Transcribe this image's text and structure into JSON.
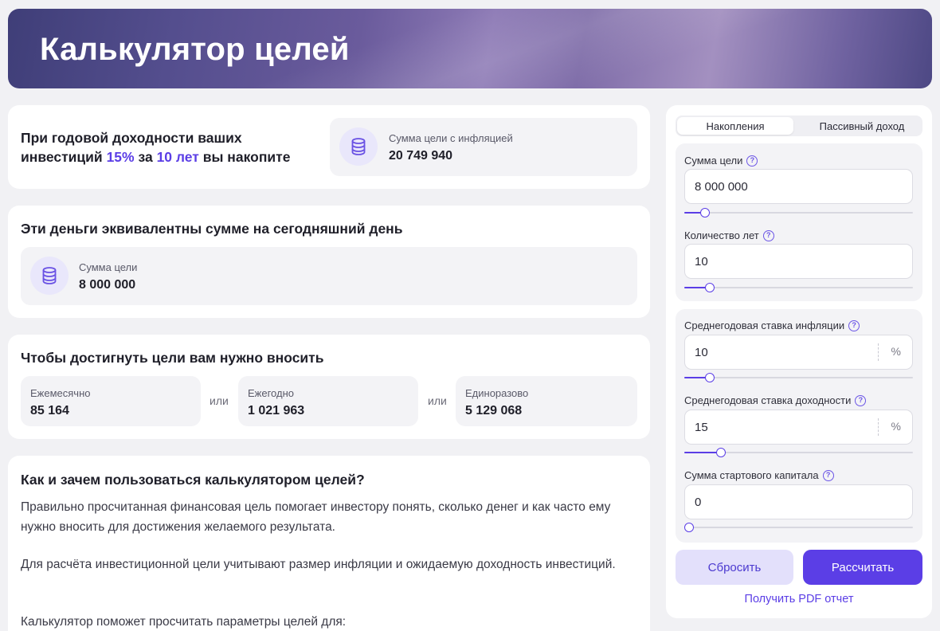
{
  "header": {
    "title": "Калькулятор целей"
  },
  "summary": {
    "line1": "При годовой доходности ваших",
    "line2_prefix": "инвестиций",
    "rate": "15%",
    "mid": "за",
    "years": "10 лет",
    "line2_suffix": "вы накопите",
    "stat_label": "Сумма цели с инфляцией",
    "stat_value": "20 749 940"
  },
  "equivalent": {
    "title": "Эти деньги эквивалентны сумме на сегодняшний день",
    "stat_label": "Сумма цели",
    "stat_value": "8 000 000"
  },
  "contributions": {
    "title": "Чтобы достигнуть цели вам нужно вносить",
    "or_label": "или",
    "items": [
      {
        "label": "Ежемесячно",
        "value": "85 164"
      },
      {
        "label": "Ежегодно",
        "value": "1 021 963"
      },
      {
        "label": "Единоразово",
        "value": "5 129 068"
      }
    ]
  },
  "info": {
    "title": "Как и зачем пользоваться калькулятором целей?",
    "paragraphs": [
      "Правильно просчитанная финансовая цель помогает инвестору понять, сколько денег и как часто ему нужно вносить для достижения желаемого результата.",
      "Для расчёта инвестиционной цели учитывают размер инфляции и ожидаемую доходность инвестиций.",
      "Калькулятор поможет просчитать параметры целей для:"
    ]
  },
  "sidebar": {
    "tabs": [
      {
        "label": "Накопления",
        "active": true
      },
      {
        "label": "Пассивный доход",
        "active": false
      }
    ],
    "help_glyph": "?",
    "fields": [
      {
        "label": "Сумма цели",
        "value": "8 000 000",
        "unit": "",
        "slider_level": 0.09
      },
      {
        "label": "Количество лет",
        "value": "10",
        "unit": "",
        "slider_level": 0.11
      },
      {
        "label": "Среднегодовая ставка инфляции",
        "value": "10",
        "unit": "%",
        "slider_level": 0.11
      },
      {
        "label": "Среднегодовая ставка доходности",
        "value": "15",
        "unit": "%",
        "slider_level": 0.16
      },
      {
        "label": "Сумма стартового капитала",
        "value": "0",
        "unit": "",
        "slider_level": 0.0
      }
    ],
    "reset_label": "Сбросить",
    "calc_label": "Рассчитать",
    "pdf_label": "Получить PDF отчет"
  },
  "colors": {
    "accent": "#5b3ee6",
    "accent_soft": "#e3e0fb",
    "surface": "#f3f3f6",
    "page": "#f1f1f4"
  },
  "icons": {
    "stat": "coins-stack-icon",
    "help": "question-circle-icon"
  }
}
